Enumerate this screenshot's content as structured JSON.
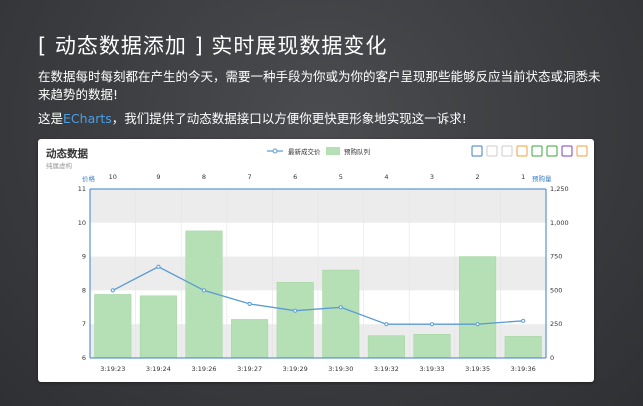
{
  "heading": "[ 动态数据添加 ] 实时展现数据变化",
  "intro": "在数据每时每刻都在产生的今天，需要一种手段为你或为你的客户呈现那些能够反应当前状态或洞悉未来趋势的数据!",
  "promo": {
    "prefix": "这是",
    "brand": "ECharts",
    "suffix": "，我们提供了动态数据接口以方便你更快更形象地实现这一诉求!"
  },
  "colors": {
    "brand": "#4a9fe6",
    "line": "#5b9bd5",
    "bar": "#b5e0b5",
    "bar_border": "#a6d6a6",
    "axis": "#3b7fc4",
    "band": "#ececec"
  },
  "toolbar": {
    "icons": [
      "mark-pen-icon",
      "mark-undo-icon",
      "mark-clear-icon",
      "data-view-icon",
      "line-chart-icon",
      "bar-chart-icon",
      "restore-icon",
      "save-image-icon"
    ],
    "colors": [
      "#3b7fc4",
      "#cccccc",
      "#cccccc",
      "#e8a33d",
      "#3aa63a",
      "#3aa63a",
      "#7b3fc4",
      "#e8a33d"
    ]
  },
  "chart_data": {
    "type": "bar+line",
    "title": "动态数据",
    "subtitle": "纯属虚构",
    "legend": [
      "最新成交价",
      "预购队列"
    ],
    "legend_position": "top-center",
    "categories": [
      "3:19:23",
      "3:19:24",
      "3:19:26",
      "3:19:27",
      "3:19:29",
      "3:19:30",
      "3:19:32",
      "3:19:33",
      "3:19:35",
      "3:19:36"
    ],
    "top_categories": [
      "10",
      "9",
      "8",
      "7",
      "6",
      "5",
      "4",
      "3",
      "2",
      "1"
    ],
    "top_left_label": "价格",
    "top_right_label": "预购量",
    "left_axis": {
      "min": 6,
      "max": 11,
      "ticks": [
        "11",
        "10",
        "9",
        "8",
        "7",
        "6"
      ]
    },
    "right_axis": {
      "min": 0,
      "max": 1250,
      "ticks": [
        "1,250",
        "1,000",
        "750",
        "500",
        "250",
        "0"
      ]
    },
    "grid": true,
    "series": [
      {
        "name": "预购队列",
        "type": "bar",
        "axis": "right",
        "values": [
          470,
          460,
          940,
          285,
          560,
          650,
          165,
          175,
          750,
          160
        ]
      },
      {
        "name": "最新成交价",
        "type": "line",
        "axis": "left",
        "values": [
          8.0,
          8.7,
          8.0,
          7.6,
          7.4,
          7.5,
          7.0,
          7.0,
          7.0,
          7.1
        ]
      }
    ]
  }
}
